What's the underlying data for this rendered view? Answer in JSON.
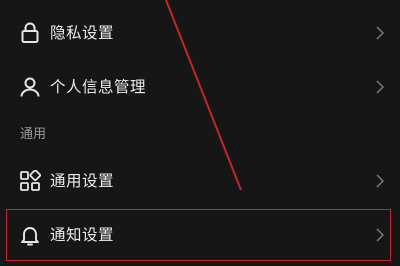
{
  "settings": {
    "items": [
      {
        "label": "隐私设置",
        "icon": "lock-icon"
      },
      {
        "label": "个人信息管理",
        "icon": "person-icon"
      }
    ],
    "section_general": "通用",
    "general_items": [
      {
        "label": "通用设置",
        "icon": "grid-icon"
      },
      {
        "label": "通知设置",
        "icon": "bell-icon"
      }
    ]
  },
  "annotation": {
    "color": "#c0282a",
    "highlighted_item": "通知设置"
  }
}
